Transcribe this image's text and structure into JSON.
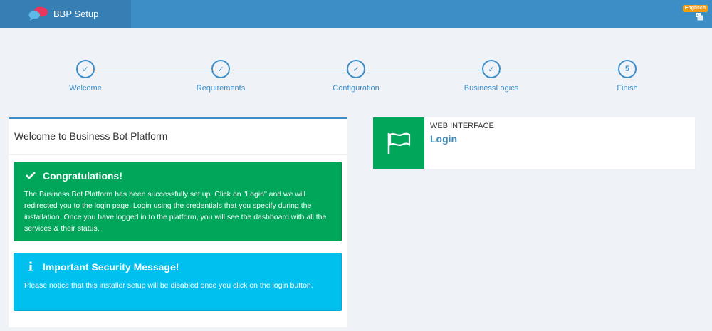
{
  "header": {
    "title": "BBP Setup",
    "language_badge": "Englisch",
    "logo_icon": "chat-bubbles-icon",
    "language_icon": "language-icon"
  },
  "steps": [
    {
      "label": "Welcome",
      "mark": "✓",
      "state": "done"
    },
    {
      "label": "Requirements",
      "mark": "✓",
      "state": "done"
    },
    {
      "label": "Configuration",
      "mark": "✓",
      "state": "done"
    },
    {
      "label": "BusinessLogics",
      "mark": "✓",
      "state": "done"
    },
    {
      "label": "Finish",
      "mark": "5",
      "state": "current"
    }
  ],
  "panel": {
    "title": "Welcome to Business Bot Platform"
  },
  "alerts": {
    "success": {
      "title": "Congratulations!",
      "icon": "check-icon",
      "body": "The Business Bot Platform has been successfully set up. Click on \"Login\" and we will redirected you to the login page. Login using the credentials that you specify during the installation. Once you have logged in to the platform, you will see the dashboard with all the services & their status."
    },
    "info": {
      "title": "Important Security Message!",
      "icon": "info-icon",
      "body": "Please notice that this installer setup will be disabled once you click on the login button."
    }
  },
  "infobox": {
    "label": "WEB INTERFACE",
    "link": "Login",
    "icon": "flag-icon"
  },
  "colors": {
    "header": "#3d8ec6",
    "brand": "#357fb4",
    "success": "#00a65a",
    "info": "#00c0ef",
    "link": "#3c8dbc",
    "badge": "#f39c12"
  }
}
